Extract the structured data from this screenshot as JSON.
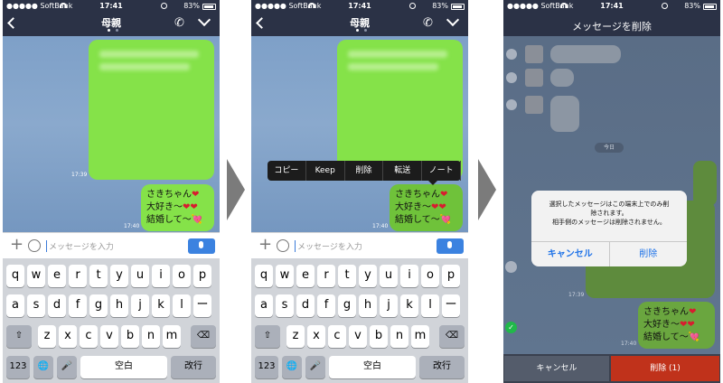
{
  "status": {
    "carrier": "●●●●● SoftBank",
    "time": "17:41",
    "battery": "83%"
  },
  "chat": {
    "title": "母親",
    "delete_title": "メッセージを削除",
    "time1": "17:39",
    "time2": "17:40",
    "message_lines": [
      "さきちゃん",
      "大好き〜",
      "結婚して〜"
    ],
    "heart": "❤",
    "hearts2": "❤❤",
    "arrow_heart": "💘",
    "date_chip": "今日"
  },
  "input": {
    "placeholder": "メッセージを入力"
  },
  "keyboard": {
    "row1": [
      "q",
      "w",
      "e",
      "r",
      "t",
      "y",
      "u",
      "i",
      "o",
      "p"
    ],
    "row2": [
      "a",
      "s",
      "d",
      "f",
      "g",
      "h",
      "j",
      "k",
      "l",
      "ー"
    ],
    "row3": [
      "z",
      "x",
      "c",
      "v",
      "b",
      "n",
      "m"
    ],
    "shift": "⇧",
    "backspace": "⌫",
    "num": "123",
    "globe": "🌐",
    "mic": "🎤",
    "space": "空白",
    "return": "改行"
  },
  "context_menu": [
    "コピー",
    "Keep",
    "削除",
    "転送",
    "ノート"
  ],
  "dialog": {
    "message_line1": "選択したメッセージはこの端末上でのみ削",
    "message_line2": "除されます。",
    "message_line3": "相手側のメッセージは削除されません。",
    "cancel": "キャンセル",
    "delete": "削除"
  },
  "bottom": {
    "cancel": "キャンセル",
    "delete": "削除 (1)"
  },
  "colors": {
    "bubble": "#85e249",
    "navbar": "#2b3246",
    "delete": "#c0321b",
    "accent": "#1f73e8"
  }
}
